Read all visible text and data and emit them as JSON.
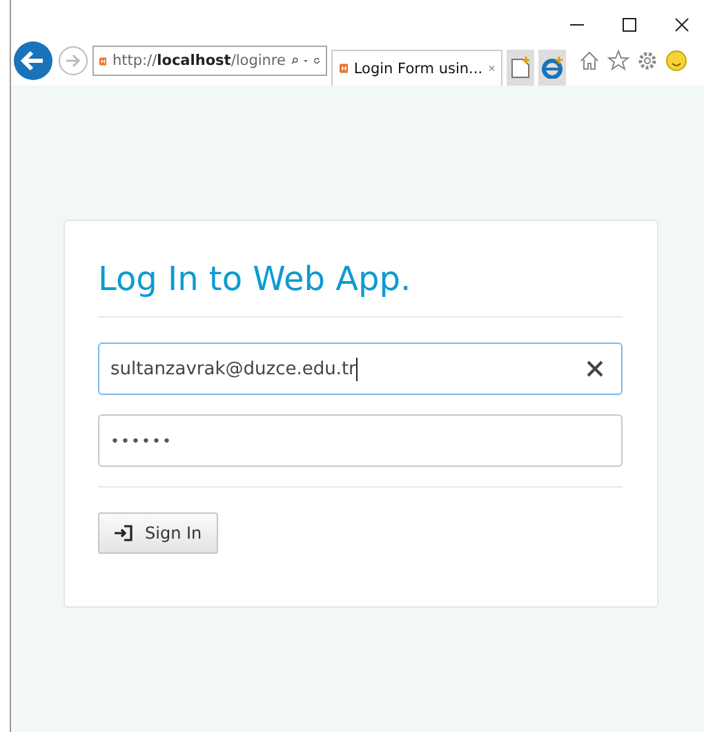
{
  "browser": {
    "address": "http://**localhost**/loginre",
    "tab": {
      "title": "Login Form usin...",
      "selected": true
    }
  },
  "login": {
    "title": "Log In to Web App.",
    "fields": [
      {
        "kind": "email",
        "value": "sultanzavrak@duzce.edu.tr",
        "focused": true
      },
      {
        "kind": "password",
        "value": "••••••",
        "focused": false
      }
    ],
    "button": "Sign In"
  }
}
